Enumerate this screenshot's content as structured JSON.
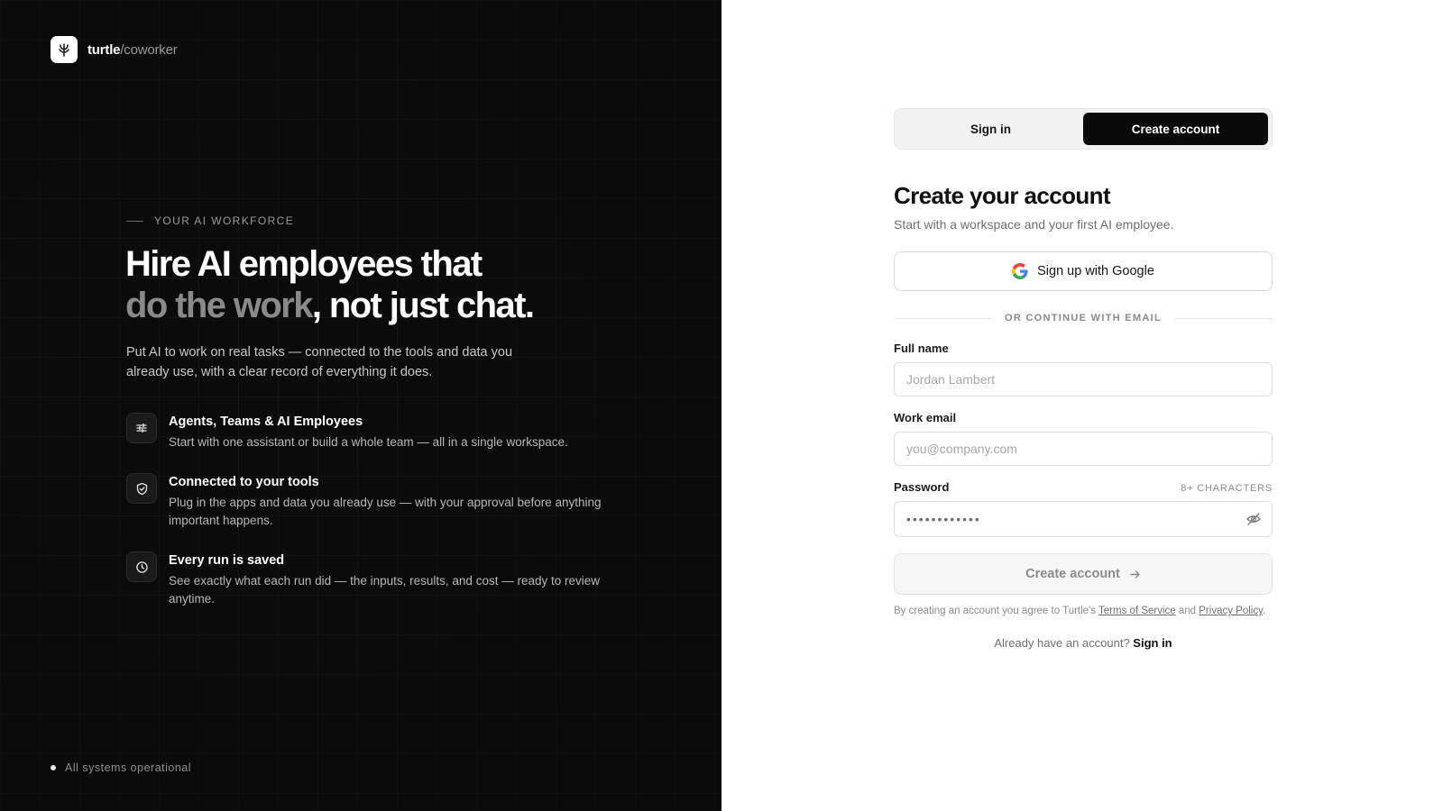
{
  "brand": {
    "name_bold": "turtle",
    "name_light": "/coworker"
  },
  "hero": {
    "eyebrow": "YOUR AI WORKFORCE",
    "headline_line1": "Hire AI employees that",
    "headline_muted": "do the work",
    "headline_rest": ", not just chat.",
    "intro": "Put AI to work on real tasks — connected to the tools and data you already use, with a clear record of everything it does."
  },
  "features": [
    {
      "icon": "sliders-icon",
      "title": "Agents, Teams & AI Employees",
      "desc": "Start with one assistant or build a whole team — all in a single workspace."
    },
    {
      "icon": "shield-check-icon",
      "title": "Connected to your tools",
      "desc": "Plug in the apps and data you already use — with your approval before anything important happens."
    },
    {
      "icon": "clock-icon",
      "title": "Every run is saved",
      "desc": "See exactly what each run did — the inputs, results, and cost — ready to review anytime."
    }
  ],
  "status": {
    "text": "All systems operational"
  },
  "auth": {
    "tabs": {
      "signin": "Sign in",
      "create": "Create account"
    },
    "active_tab": "create",
    "title": "Create your account",
    "subtitle": "Start with a workspace and your first AI employee.",
    "google_label": "Sign up with Google",
    "divider": "OR CONTINUE WITH EMAIL",
    "fields": {
      "fullname": {
        "label": "Full name",
        "placeholder": "Jordan Lambert",
        "value": ""
      },
      "email": {
        "label": "Work email",
        "placeholder": "you@company.com",
        "value": ""
      },
      "password": {
        "label": "Password",
        "hint": "8+ CHARACTERS",
        "value": "••••••••••••"
      }
    },
    "submit_label": "Create account",
    "legal_prefix": "By creating an account you agree to Turtle's",
    "legal_terms": "Terms of Service",
    "legal_and": "and",
    "legal_privacy": "Privacy Policy",
    "legal_end": ".",
    "switch_prompt": "Already have an account?",
    "switch_link": "Sign in"
  },
  "colors": {
    "dark_bg": "#0b0b0b",
    "accent_dark": "#0a0a0a",
    "muted_text": "#8a8a8a"
  }
}
